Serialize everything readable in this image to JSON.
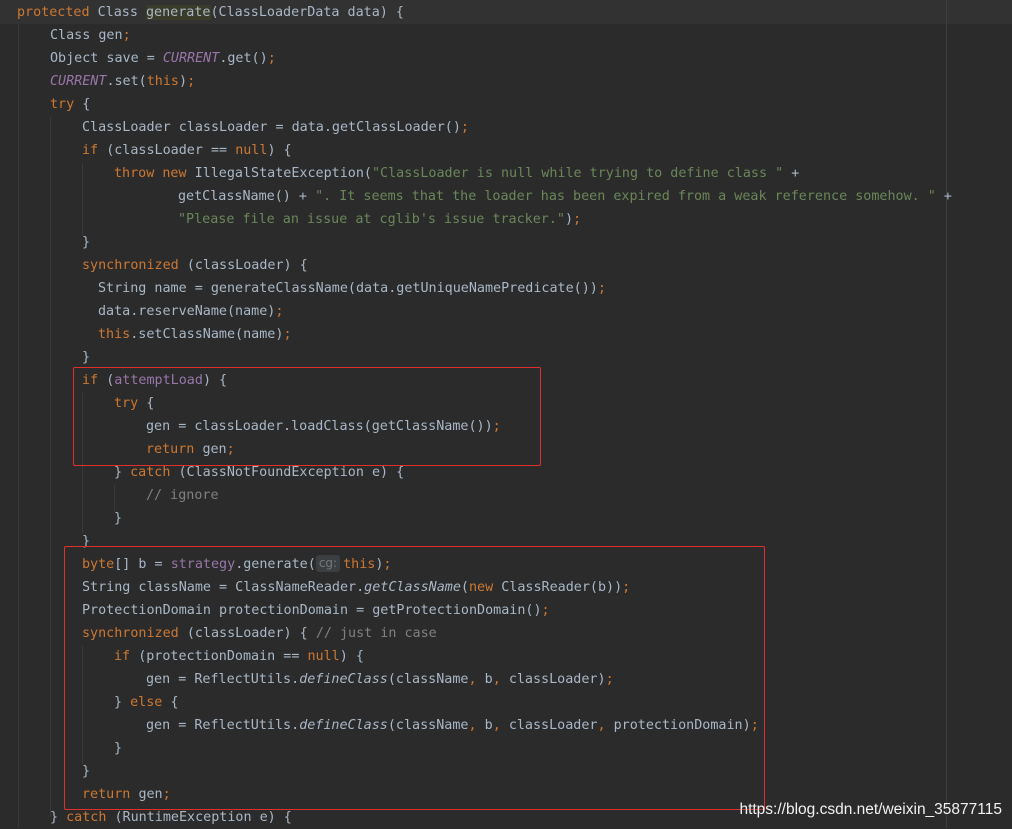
{
  "code_lines": [
    {
      "indent": 17,
      "tokens": [
        {
          "t": "protected ",
          "c": "kw"
        },
        {
          "t": "Class ",
          "c": "def"
        },
        {
          "t": "generate",
          "c": "fn"
        },
        {
          "t": "(ClassLoaderData data) {",
          "c": "def"
        }
      ]
    },
    {
      "indent": 50,
      "tokens": [
        {
          "t": "Class gen",
          "c": "def"
        },
        {
          "t": ";",
          "c": "kw"
        }
      ]
    },
    {
      "indent": 50,
      "tokens": [
        {
          "t": "Object save = ",
          "c": "def"
        },
        {
          "t": "CURRENT",
          "c": "sfield"
        },
        {
          "t": ".get()",
          "c": "def"
        },
        {
          "t": ";",
          "c": "kw"
        }
      ]
    },
    {
      "indent": 50,
      "tokens": [
        {
          "t": "CURRENT",
          "c": "sfield"
        },
        {
          "t": ".set(",
          "c": "def"
        },
        {
          "t": "this",
          "c": "kw"
        },
        {
          "t": ")",
          "c": "def"
        },
        {
          "t": ";",
          "c": "kw"
        }
      ]
    },
    {
      "indent": 50,
      "tokens": [
        {
          "t": "try ",
          "c": "kw"
        },
        {
          "t": "{",
          "c": "def"
        }
      ]
    },
    {
      "indent": 82,
      "tokens": [
        {
          "t": "ClassLoader classLoader = data.getClassLoader()",
          "c": "def"
        },
        {
          "t": ";",
          "c": "kw"
        }
      ]
    },
    {
      "indent": 82,
      "tokens": [
        {
          "t": "if ",
          "c": "kw"
        },
        {
          "t": "(classLoader == ",
          "c": "def"
        },
        {
          "t": "null",
          "c": "kw"
        },
        {
          "t": ") {",
          "c": "def"
        }
      ]
    },
    {
      "indent": 114,
      "tokens": [
        {
          "t": "throw new ",
          "c": "kw"
        },
        {
          "t": "IllegalStateException(",
          "c": "def"
        },
        {
          "t": "\"ClassLoader is null while trying to define class \"",
          "c": "str"
        },
        {
          "t": " +",
          "c": "def"
        }
      ]
    },
    {
      "indent": 178,
      "tokens": [
        {
          "t": "getClassName() + ",
          "c": "def"
        },
        {
          "t": "\". It seems that the loader has been expired from a weak reference somehow. \"",
          "c": "str"
        },
        {
          "t": " +",
          "c": "def"
        }
      ]
    },
    {
      "indent": 178,
      "tokens": [
        {
          "t": "\"Please file an issue at cglib's issue tracker.\"",
          "c": "str"
        },
        {
          "t": ")",
          "c": "def"
        },
        {
          "t": ";",
          "c": "kw"
        }
      ]
    },
    {
      "indent": 82,
      "tokens": [
        {
          "t": "}",
          "c": "def"
        }
      ]
    },
    {
      "indent": 82,
      "tokens": [
        {
          "t": "synchronized ",
          "c": "kw"
        },
        {
          "t": "(classLoader) {",
          "c": "def"
        }
      ]
    },
    {
      "indent": 98,
      "tokens": [
        {
          "t": "String name = generateClassName(data.getUniqueNamePredicate())",
          "c": "def"
        },
        {
          "t": ";",
          "c": "kw"
        }
      ]
    },
    {
      "indent": 98,
      "tokens": [
        {
          "t": "data.reserveName(name)",
          "c": "def"
        },
        {
          "t": ";",
          "c": "kw"
        }
      ]
    },
    {
      "indent": 98,
      "tokens": [
        {
          "t": "this",
          "c": "kw"
        },
        {
          "t": ".setClassName(name)",
          "c": "def"
        },
        {
          "t": ";",
          "c": "kw"
        }
      ]
    },
    {
      "indent": 82,
      "tokens": [
        {
          "t": "}",
          "c": "def"
        }
      ]
    },
    {
      "indent": 82,
      "tokens": [
        {
          "t": "if ",
          "c": "kw"
        },
        {
          "t": "(",
          "c": "def"
        },
        {
          "t": "attemptLoad",
          "c": "field"
        },
        {
          "t": ") {",
          "c": "def"
        }
      ]
    },
    {
      "indent": 114,
      "tokens": [
        {
          "t": "try ",
          "c": "kw"
        },
        {
          "t": "{",
          "c": "def"
        }
      ]
    },
    {
      "indent": 146,
      "tokens": [
        {
          "t": "gen = classLoader.loadClass(getClassName())",
          "c": "def"
        },
        {
          "t": ";",
          "c": "kw"
        }
      ]
    },
    {
      "indent": 146,
      "tokens": [
        {
          "t": "return ",
          "c": "kw"
        },
        {
          "t": "gen",
          "c": "def"
        },
        {
          "t": ";",
          "c": "kw"
        }
      ]
    },
    {
      "indent": 114,
      "tokens": [
        {
          "t": "} ",
          "c": "def"
        },
        {
          "t": "catch ",
          "c": "kw"
        },
        {
          "t": "(ClassNotFoundException e) {",
          "c": "def"
        }
      ]
    },
    {
      "indent": 146,
      "tokens": [
        {
          "t": "// ignore",
          "c": "cm"
        }
      ]
    },
    {
      "indent": 114,
      "tokens": [
        {
          "t": "}",
          "c": "def"
        }
      ]
    },
    {
      "indent": 82,
      "tokens": [
        {
          "t": "}",
          "c": "def"
        }
      ]
    },
    {
      "indent": 82,
      "tokens": [
        {
          "t": "byte",
          "c": "kw"
        },
        {
          "t": "[] b = ",
          "c": "def"
        },
        {
          "t": "strategy",
          "c": "field"
        },
        {
          "t": ".generate(",
          "c": "def"
        },
        {
          "t": "cg:",
          "c": "hint"
        },
        {
          "t": "this",
          "c": "kw"
        },
        {
          "t": ")",
          "c": "def"
        },
        {
          "t": ";",
          "c": "kw"
        }
      ]
    },
    {
      "indent": 82,
      "tokens": [
        {
          "t": "String className = ClassNameReader.",
          "c": "def"
        },
        {
          "t": "getClassName",
          "c": "smeth"
        },
        {
          "t": "(",
          "c": "def"
        },
        {
          "t": "new ",
          "c": "kw"
        },
        {
          "t": "ClassReader(b))",
          "c": "def"
        },
        {
          "t": ";",
          "c": "kw"
        }
      ]
    },
    {
      "indent": 82,
      "tokens": [
        {
          "t": "ProtectionDomain protectionDomain = getProtectionDomain()",
          "c": "def"
        },
        {
          "t": ";",
          "c": "kw"
        }
      ]
    },
    {
      "indent": 82,
      "tokens": [
        {
          "t": "synchronized ",
          "c": "kw"
        },
        {
          "t": "(classLoader) { ",
          "c": "def"
        },
        {
          "t": "// just in case",
          "c": "cm"
        }
      ]
    },
    {
      "indent": 114,
      "tokens": [
        {
          "t": "if ",
          "c": "kw"
        },
        {
          "t": "(protectionDomain == ",
          "c": "def"
        },
        {
          "t": "null",
          "c": "kw"
        },
        {
          "t": ") {",
          "c": "def"
        }
      ]
    },
    {
      "indent": 146,
      "tokens": [
        {
          "t": "gen = ReflectUtils.",
          "c": "def"
        },
        {
          "t": "defineClass",
          "c": "smeth"
        },
        {
          "t": "(className",
          "c": "def"
        },
        {
          "t": ", ",
          "c": "kw"
        },
        {
          "t": "b",
          "c": "def"
        },
        {
          "t": ", ",
          "c": "kw"
        },
        {
          "t": "classLoader)",
          "c": "def"
        },
        {
          "t": ";",
          "c": "kw"
        }
      ]
    },
    {
      "indent": 114,
      "tokens": [
        {
          "t": "} ",
          "c": "def"
        },
        {
          "t": "else ",
          "c": "kw"
        },
        {
          "t": "{",
          "c": "def"
        }
      ]
    },
    {
      "indent": 146,
      "tokens": [
        {
          "t": "gen = ReflectUtils.",
          "c": "def"
        },
        {
          "t": "defineClass",
          "c": "smeth"
        },
        {
          "t": "(className",
          "c": "def"
        },
        {
          "t": ", ",
          "c": "kw"
        },
        {
          "t": "b",
          "c": "def"
        },
        {
          "t": ", ",
          "c": "kw"
        },
        {
          "t": "classLoader",
          "c": "def"
        },
        {
          "t": ", ",
          "c": "kw"
        },
        {
          "t": "protectionDomain)",
          "c": "def"
        },
        {
          "t": ";",
          "c": "kw"
        }
      ]
    },
    {
      "indent": 114,
      "tokens": [
        {
          "t": "}",
          "c": "def"
        }
      ]
    },
    {
      "indent": 82,
      "tokens": [
        {
          "t": "}",
          "c": "def"
        }
      ]
    },
    {
      "indent": 82,
      "tokens": [
        {
          "t": "return ",
          "c": "kw"
        },
        {
          "t": "gen",
          "c": "def"
        },
        {
          "t": ";",
          "c": "kw"
        }
      ]
    },
    {
      "indent": 50,
      "tokens": [
        {
          "t": "} ",
          "c": "def"
        },
        {
          "t": "catch ",
          "c": "kw"
        },
        {
          "t": "(RuntimeException e) {",
          "c": "def"
        }
      ]
    }
  ],
  "watermark": "https://blog.csdn.net/weixin_35877115",
  "colors": {
    "background": "#2b2b2b",
    "keyword": "#cc7832",
    "string": "#6a8759",
    "field": "#9876aa",
    "comment": "#808080",
    "method_decl": "#ffc66d",
    "annotation_box": "#e0302e"
  }
}
